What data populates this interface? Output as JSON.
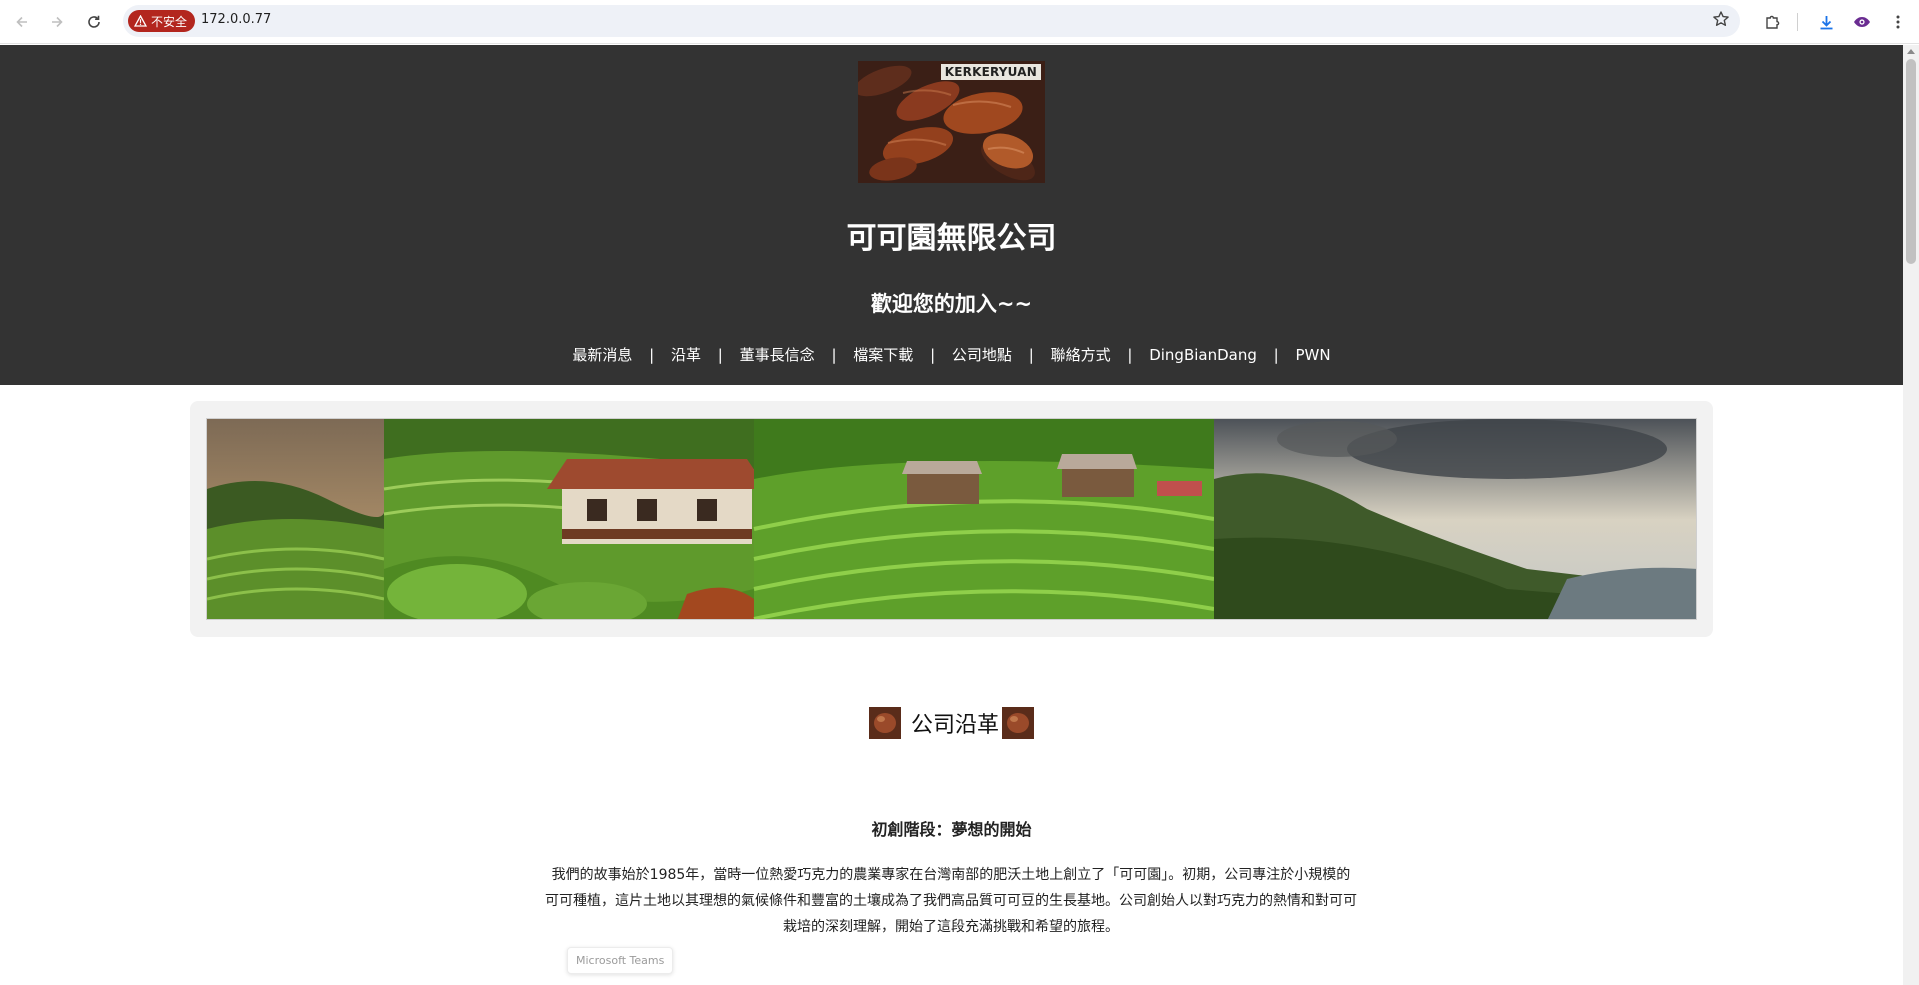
{
  "browser": {
    "security_label": "不安全",
    "url": "172.0.0.77",
    "icons": {
      "back": "arrow-left-icon",
      "forward": "arrow-right-icon",
      "reload": "reload-icon",
      "warning": "warning-triangle-icon",
      "bookmark": "star-icon",
      "extensions": "puzzle-icon",
      "downloads": "download-icon",
      "profile": "eye-extension-icon",
      "menu": "kebab-menu-icon"
    }
  },
  "header": {
    "logo_text": "KERKERYUAN",
    "title": "可可園無限公司",
    "subtitle": "歡迎您的加入~~",
    "nav": [
      "最新消息",
      "沿革",
      "董事長信念",
      "檔案下載",
      "公司地點",
      "聯絡方式",
      "DingBianDang",
      "PWN"
    ],
    "nav_separator": "|",
    "background_color": "#333333"
  },
  "section": {
    "title": "公司沿革",
    "phase_title": "初創階段：夢想的開始",
    "paragraph": "我們的故事始於1985年，當時一位熱愛巧克力的農業專家在台灣南部的肥沃土地上創立了「可可園」。初期，公司專注於小規模的可可種植，這片土地以其理想的氣候條件和豐富的土壤成為了我們高品質可可豆的生長基地。公司創始人以對巧克力的熱情和對可可栽培的深刻理解，開始了這段充滿挑戰和希望的旅程。"
  },
  "tooltip": {
    "label": "Microsoft Teams"
  }
}
